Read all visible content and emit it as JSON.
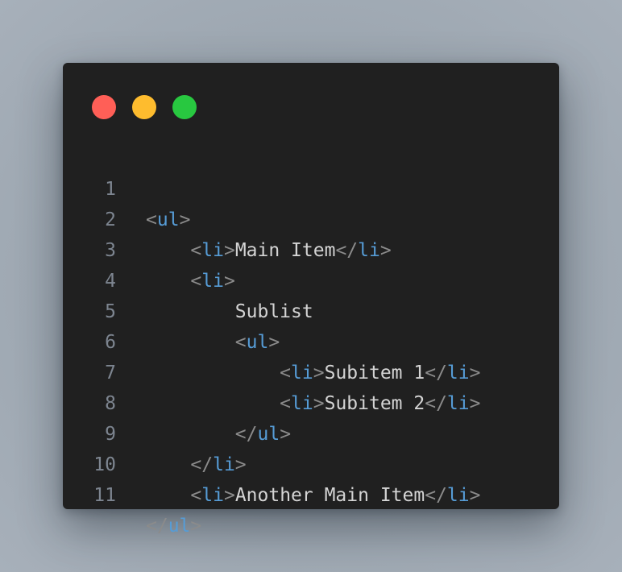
{
  "window": {
    "controls": [
      {
        "name": "close",
        "color": "#ff5f57"
      },
      {
        "name": "minimize",
        "color": "#febc2e"
      },
      {
        "name": "maximize",
        "color": "#28c840"
      }
    ]
  },
  "code": {
    "lines": [
      {
        "number": "1",
        "indent": "",
        "open_bracket": "<",
        "tag": "ul",
        "close_bracket": ">",
        "text": "",
        "end_open": "",
        "end_tag": "",
        "end_close": ""
      },
      {
        "number": "2",
        "indent": "    ",
        "open_bracket": "<",
        "tag": "li",
        "close_bracket": ">",
        "text": "Main Item",
        "end_open": "</",
        "end_tag": "li",
        "end_close": ">"
      },
      {
        "number": "3",
        "indent": "    ",
        "open_bracket": "<",
        "tag": "li",
        "close_bracket": ">",
        "text": "",
        "end_open": "",
        "end_tag": "",
        "end_close": ""
      },
      {
        "number": "4",
        "indent": "        ",
        "open_bracket": "",
        "tag": "",
        "close_bracket": "",
        "text": "Sublist",
        "end_open": "",
        "end_tag": "",
        "end_close": ""
      },
      {
        "number": "5",
        "indent": "        ",
        "open_bracket": "<",
        "tag": "ul",
        "close_bracket": ">",
        "text": "",
        "end_open": "",
        "end_tag": "",
        "end_close": ""
      },
      {
        "number": "6",
        "indent": "            ",
        "open_bracket": "<",
        "tag": "li",
        "close_bracket": ">",
        "text": "Subitem 1",
        "end_open": "</",
        "end_tag": "li",
        "end_close": ">"
      },
      {
        "number": "7",
        "indent": "            ",
        "open_bracket": "<",
        "tag": "li",
        "close_bracket": ">",
        "text": "Subitem 2",
        "end_open": "</",
        "end_tag": "li",
        "end_close": ">"
      },
      {
        "number": "8",
        "indent": "        ",
        "open_bracket": "</",
        "tag": "ul",
        "close_bracket": ">",
        "text": "",
        "end_open": "",
        "end_tag": "",
        "end_close": ""
      },
      {
        "number": "9",
        "indent": "    ",
        "open_bracket": "</",
        "tag": "li",
        "close_bracket": ">",
        "text": "",
        "end_open": "",
        "end_tag": "",
        "end_close": ""
      },
      {
        "number": "10",
        "indent": "    ",
        "open_bracket": "<",
        "tag": "li",
        "close_bracket": ">",
        "text": "Another Main Item",
        "end_open": "</",
        "end_tag": "li",
        "end_close": ">"
      },
      {
        "number": "11",
        "indent": "",
        "open_bracket": "</",
        "tag": "ul",
        "close_bracket": ">",
        "text": "",
        "end_open": "",
        "end_tag": "",
        "end_close": ""
      }
    ]
  },
  "colors": {
    "window_bg": "#202020",
    "line_number": "#7d8590",
    "punctuation": "#8b8b8b",
    "tag_name": "#569cd6",
    "text": "#d4d4d4"
  }
}
